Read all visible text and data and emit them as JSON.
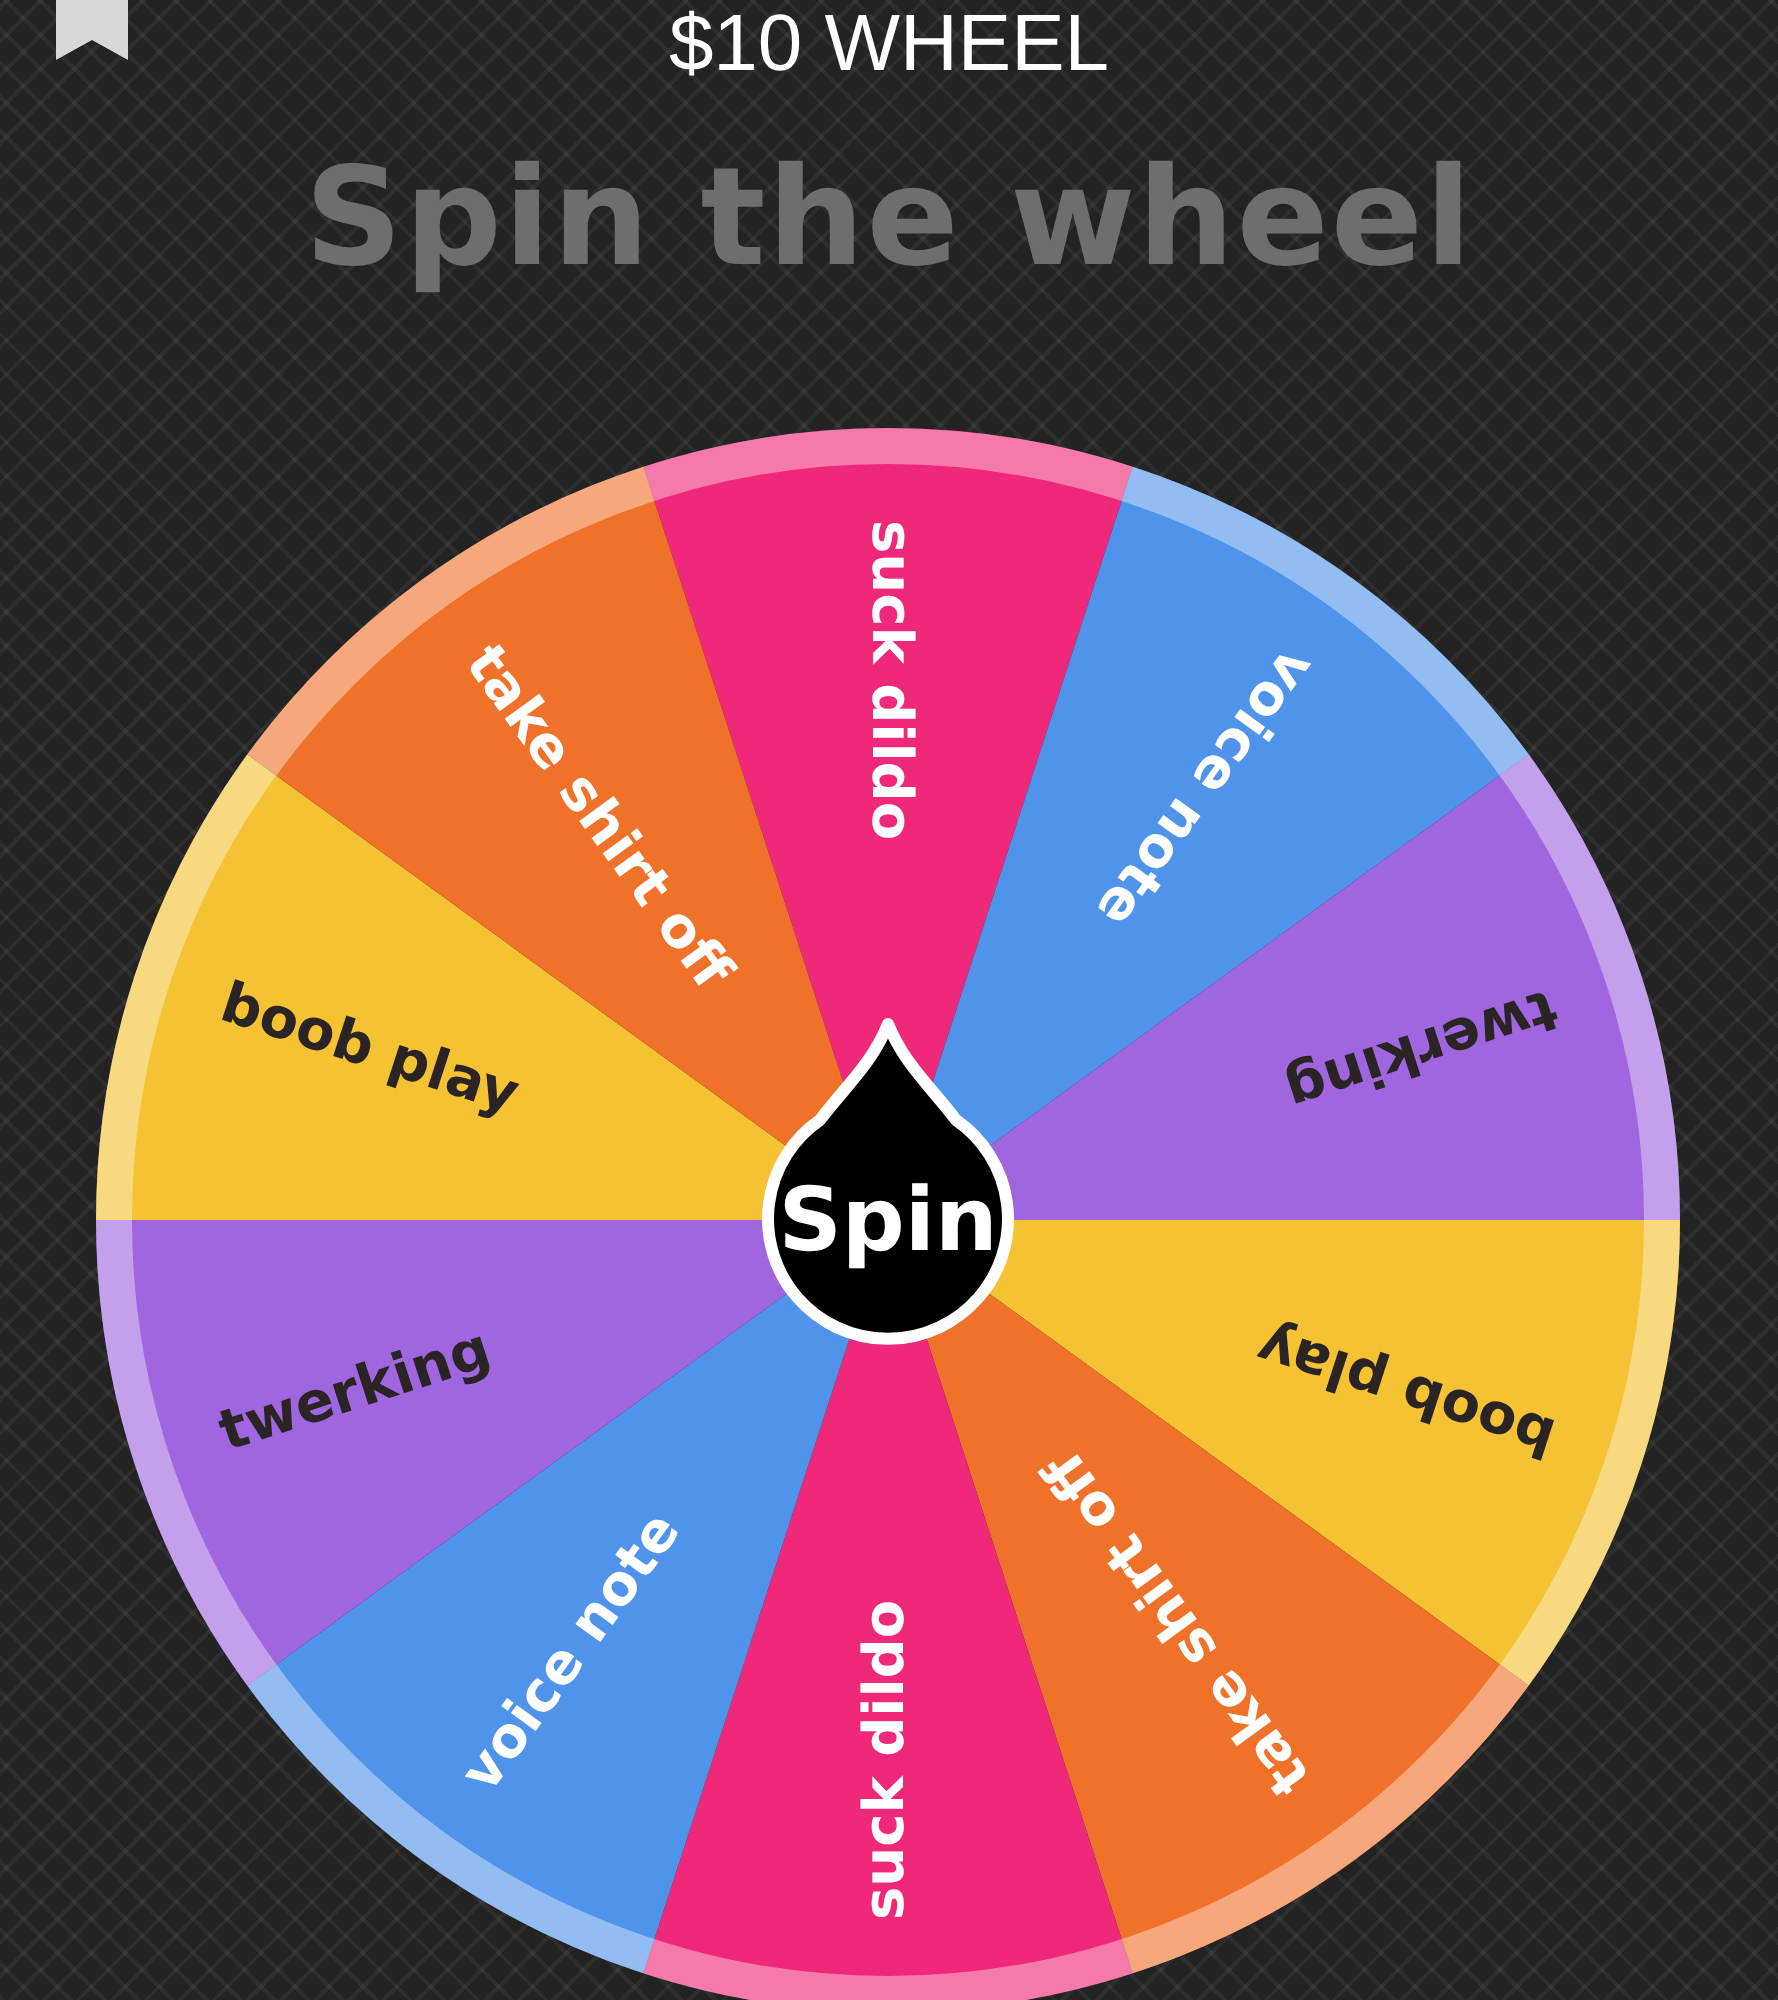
{
  "header": {
    "title": "$10 WHEEL"
  },
  "heading": "Spin the wheel",
  "wheel": {
    "segments": [
      {
        "label": "suck dildo",
        "color": "#f0287a",
        "kind": "light"
      },
      {
        "label": "voice note",
        "color": "#4f93ea",
        "kind": "light"
      },
      {
        "label": "twerking",
        "color": "#a066e0",
        "kind": "dark"
      },
      {
        "label": "boob play",
        "color": "#f4c232",
        "kind": "dark"
      },
      {
        "label": "take shirt off",
        "color": "#f0722a",
        "kind": "light"
      },
      {
        "label": "suck dildo",
        "color": "#f0287a",
        "kind": "light"
      },
      {
        "label": "voice note",
        "color": "#4f93ea",
        "kind": "light"
      },
      {
        "label": "twerking",
        "color": "#a066e0",
        "kind": "dark"
      },
      {
        "label": "boob play",
        "color": "#f4c232",
        "kind": "dark"
      },
      {
        "label": "take shirt off",
        "color": "#f0722a",
        "kind": "light"
      }
    ],
    "spin_button": "Spin"
  }
}
